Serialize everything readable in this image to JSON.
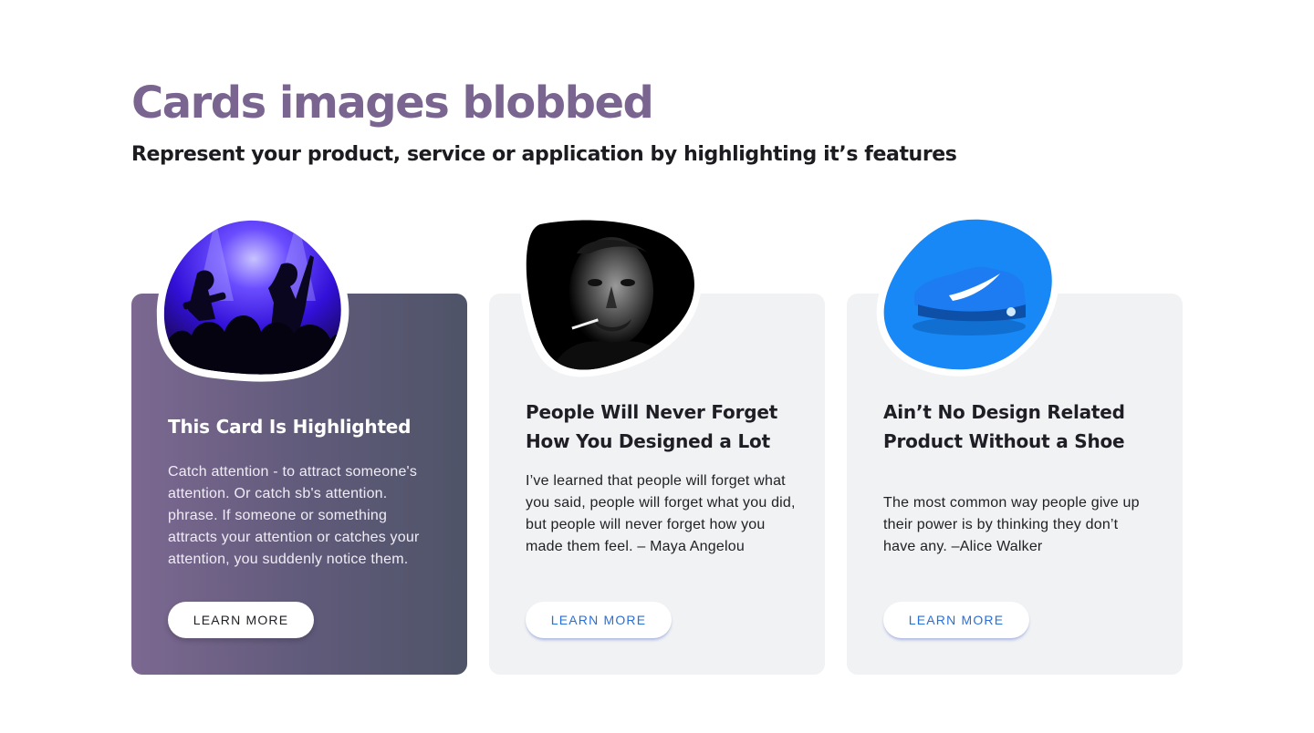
{
  "header": {
    "title": "Cards images blobbed",
    "subtitle": "Represent your product, service or application by highlighting it’s features"
  },
  "colors": {
    "title": "#7a6591",
    "highlight_gradient_start": "#7c6891",
    "highlight_gradient_end": "#4f5468",
    "card_background": "#f1f2f4",
    "button_text": "#2a6fd6"
  },
  "cards": [
    {
      "image": "concert-stage-photo",
      "title": "This Card Is Highlighted",
      "text": "Catch attention - to attract someone's attention. Or catch sb's attention. phrase. If someone or something attracts your attention or catches your attention, you suddenly notice them.",
      "button": "LEARN MORE"
    },
    {
      "image": "man-portrait-photo",
      "title": "People Will Never Forget How You Designed a Lot",
      "text": "I’ve learned that people will forget what you said, people will forget what you did, but people will never forget how you made them feel. – Maya Angelou",
      "button": "LEARN MORE"
    },
    {
      "image": "blue-sneaker-photo",
      "title": "Ain’t No Design Related Product Without a Shoe",
      "text": "The most common way people give up their power is by thinking they don’t have any. –Alice Walker",
      "button": "LEARN MORE"
    }
  ]
}
